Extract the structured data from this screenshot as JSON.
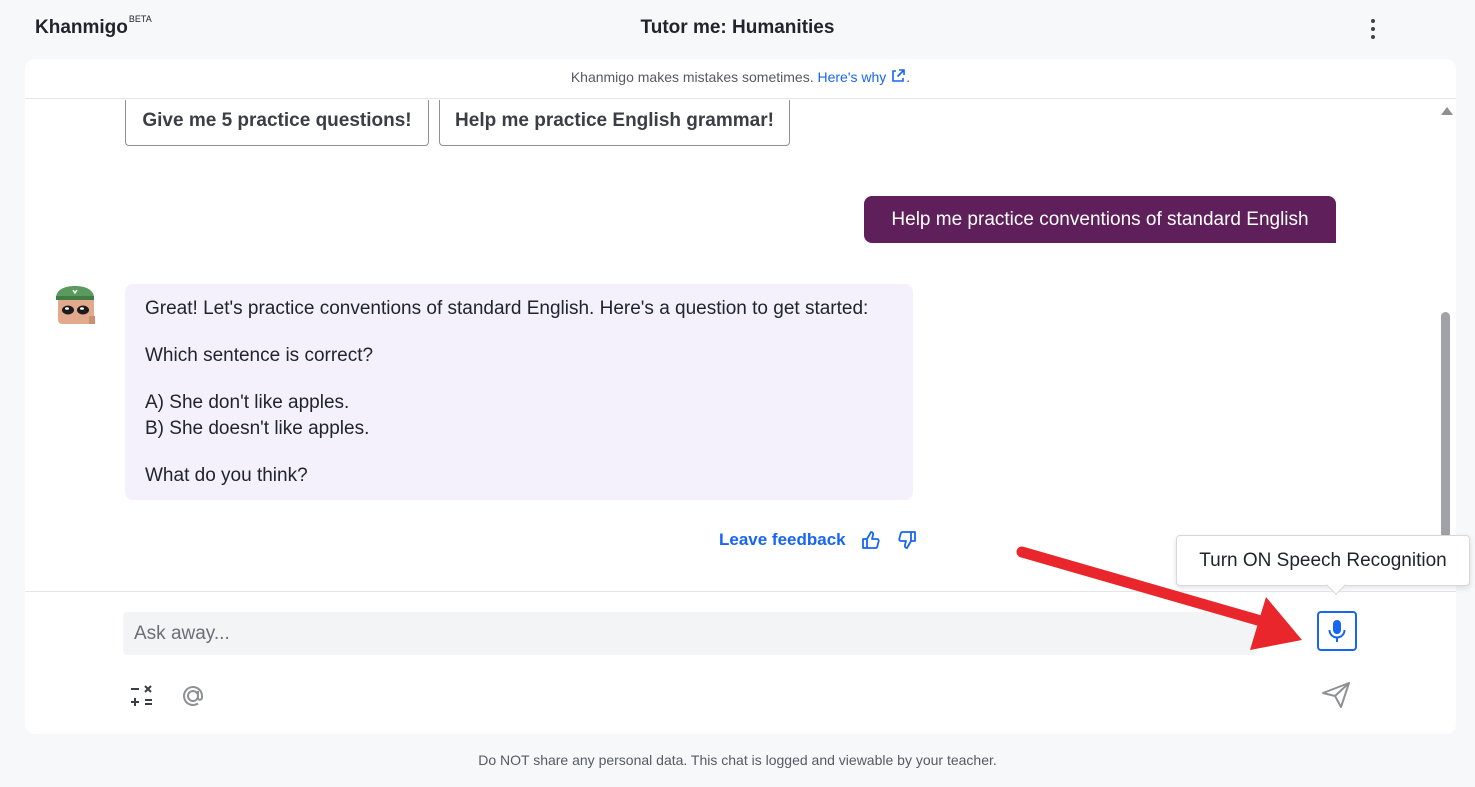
{
  "header": {
    "brand": "Khanmigo",
    "brand_badge": "BETA",
    "title": "Tutor me: Humanities"
  },
  "disclaimer": {
    "text": "Khanmigo makes mistakes sometimes. ",
    "link": "Here's why",
    "suffix": "."
  },
  "suggestions": [
    {
      "label": "Give me 5 practice questions!"
    },
    {
      "label": "Help me practice English grammar!"
    }
  ],
  "messages": {
    "user": "Help me practice conventions of standard English",
    "bot": {
      "line1": "Great! Let's practice conventions of standard English. Here's a question to get started:",
      "line2": "Which sentence is correct?",
      "option_a": "A) She don't like apples.",
      "option_b": "B) She doesn't like apples.",
      "line3": "What do you think?"
    }
  },
  "feedback": {
    "label": "Leave feedback"
  },
  "composer": {
    "placeholder": "Ask away...",
    "value": ""
  },
  "tooltip": {
    "text": "Turn ON Speech Recognition"
  },
  "footer": {
    "text": "Do NOT share any personal data. This chat is logged and viewable by your teacher."
  },
  "colors": {
    "user_bubble": "#5f1f5a",
    "bot_bubble": "#f4f1fd",
    "link": "#1865f2",
    "annotation_arrow": "#e8262b"
  },
  "icons": [
    "kebab-menu-icon",
    "external-link-icon",
    "khanmigo-avatar-icon",
    "thumbs-up-icon",
    "thumbs-down-icon",
    "microphone-icon",
    "calculator-icon",
    "at-sign-icon",
    "send-icon"
  ]
}
